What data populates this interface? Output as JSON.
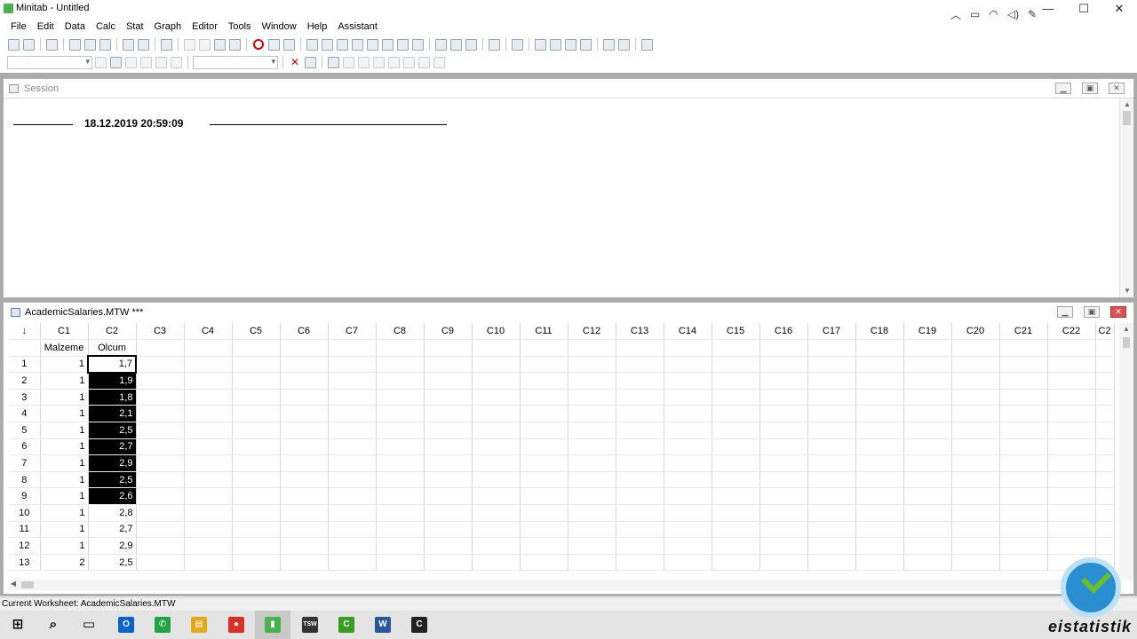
{
  "app": {
    "title": "Minitab - Untitled"
  },
  "window_controls": {
    "minimize": "—",
    "maximize": "☐",
    "close": "✕"
  },
  "menu": [
    {
      "label": "File"
    },
    {
      "label": "Edit"
    },
    {
      "label": "Data"
    },
    {
      "label": "Calc"
    },
    {
      "label": "Stat"
    },
    {
      "label": "Graph"
    },
    {
      "label": "Editor"
    },
    {
      "label": "Tools"
    },
    {
      "label": "Window"
    },
    {
      "label": "Help"
    },
    {
      "label": "Assistant"
    }
  ],
  "session": {
    "title": "Session",
    "timestamp": "18.12.2019 20:59:09"
  },
  "worksheet": {
    "title": "AcademicSalaries.MTW ***",
    "corner_glyph": "↓",
    "columns": [
      "C1",
      "C2",
      "C3",
      "C4",
      "C5",
      "C6",
      "C7",
      "C8",
      "C9",
      "C10",
      "C11",
      "C12",
      "C13",
      "C14",
      "C15",
      "C16",
      "C17",
      "C18",
      "C19",
      "C20",
      "C21",
      "C22",
      "C2"
    ],
    "names": [
      "Malzeme",
      "Olcum"
    ],
    "rows": [
      {
        "n": "1",
        "c1": "1",
        "c2": "1,7"
      },
      {
        "n": "2",
        "c1": "1",
        "c2": "1,9"
      },
      {
        "n": "3",
        "c1": "1",
        "c2": "1,8"
      },
      {
        "n": "4",
        "c1": "1",
        "c2": "2,1"
      },
      {
        "n": "5",
        "c1": "1",
        "c2": "2,5"
      },
      {
        "n": "6",
        "c1": "1",
        "c2": "2,7"
      },
      {
        "n": "7",
        "c1": "1",
        "c2": "2,9"
      },
      {
        "n": "8",
        "c1": "1",
        "c2": "2,5"
      },
      {
        "n": "9",
        "c1": "1",
        "c2": "2,6"
      },
      {
        "n": "10",
        "c1": "1",
        "c2": "2,8"
      },
      {
        "n": "11",
        "c1": "1",
        "c2": "2,7"
      },
      {
        "n": "12",
        "c1": "1",
        "c2": "2,9"
      },
      {
        "n": "13",
        "c1": "2",
        "c2": "2,5"
      }
    ],
    "selected_rows_c2": [
      "1",
      "2",
      "3",
      "4",
      "5",
      "6",
      "7",
      "8",
      "9"
    ]
  },
  "status": {
    "text": "Current Worksheet: AcademicSalaries.MTW"
  },
  "taskbar": {
    "apps": [
      {
        "name": "start",
        "glyph": "⊞",
        "color": "#000000"
      },
      {
        "name": "search",
        "glyph": "⌕",
        "color": "#000000"
      },
      {
        "name": "task-view",
        "glyph": "▭",
        "color": "#000000"
      },
      {
        "name": "outlook",
        "glyph": "O",
        "color": "#0a64c8"
      },
      {
        "name": "whatsapp",
        "glyph": "✆",
        "color": "#25a244"
      },
      {
        "name": "file-explorer",
        "glyph": "▤",
        "color": "#e6a817"
      },
      {
        "name": "chrome",
        "glyph": "●",
        "color": "#d93025"
      },
      {
        "name": "minitab",
        "glyph": "▮",
        "color": "#4caf50"
      },
      {
        "name": "tsw",
        "glyph": "TSW",
        "color": "#333333"
      },
      {
        "name": "camtasia",
        "glyph": "C",
        "color": "#3a9d23"
      },
      {
        "name": "word",
        "glyph": "W",
        "color": "#2b579a"
      },
      {
        "name": "camtasia-2",
        "glyph": "C",
        "color": "#222222"
      }
    ]
  },
  "watermark": {
    "text": "eistatistik"
  }
}
